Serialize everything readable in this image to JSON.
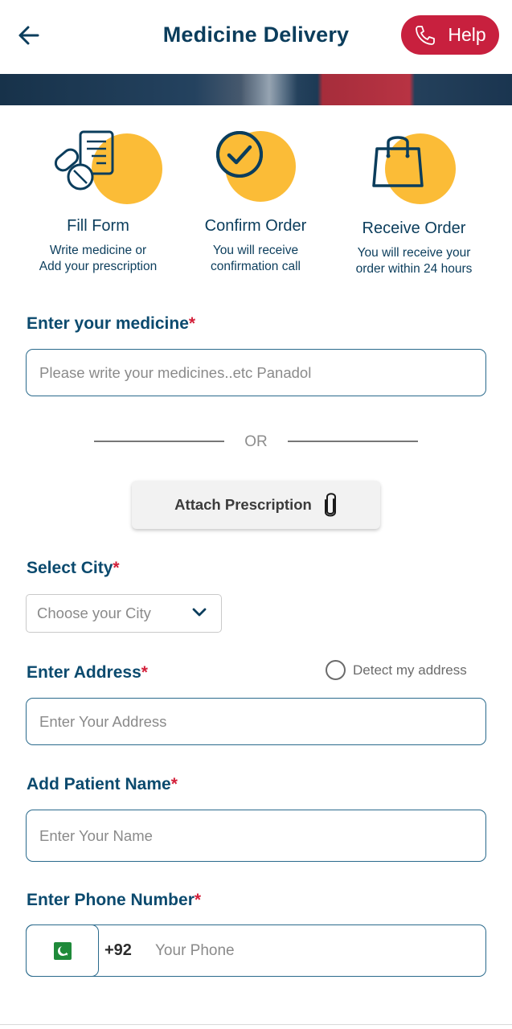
{
  "header": {
    "title": "Medicine Delivery",
    "help_label": "Help",
    "back_icon": "arrow-left-icon",
    "phone_icon": "phone-icon"
  },
  "steps": [
    {
      "title": "Fill Form",
      "line1": "Write medicine or",
      "line2": "Add your prescription",
      "icon": "prescription-pills-icon"
    },
    {
      "title": "Confirm Order",
      "line1": "You will receive",
      "line2": "confirmation call",
      "icon": "check-circle-icon"
    },
    {
      "title": "Receive Order",
      "line1": "You will receive your",
      "line2": "order within 24 hours",
      "icon": "shopping-bag-icon"
    }
  ],
  "form": {
    "medicine": {
      "label": "Enter your medicine",
      "required": "*",
      "placeholder": "Please write your medicines..etc Panadol",
      "value": ""
    },
    "or_text": "OR",
    "attach_label": "Attach Prescription",
    "city": {
      "label": "Select City",
      "required": "*",
      "selected": "Choose your City"
    },
    "address": {
      "label": "Enter Address",
      "required": "*",
      "placeholder": "Enter Your Address",
      "detect_label": "Detect my address",
      "value": ""
    },
    "patient": {
      "label": "Add Patient Name",
      "required": "*",
      "placeholder": "Enter Your Name",
      "value": ""
    },
    "phone": {
      "label": "Enter Phone Number",
      "required": "*",
      "country_code": "+92",
      "placeholder": "Your Phone",
      "flag": "pakistan-flag-icon",
      "value": ""
    }
  },
  "colors": {
    "primary": "#0b3d5c",
    "accent_red": "#c8203e",
    "yellow": "#fbbc37",
    "required": "#d3203a"
  }
}
